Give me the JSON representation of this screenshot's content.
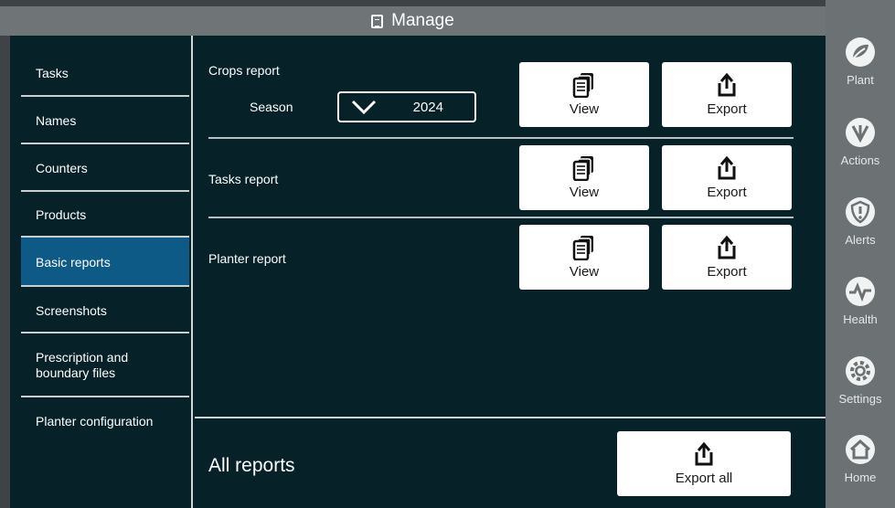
{
  "titlebar": {
    "title": "Manage",
    "icon": "document-icon"
  },
  "sidebar": {
    "items": [
      {
        "label": "Tasks",
        "active": false
      },
      {
        "label": "Names",
        "active": false
      },
      {
        "label": "Counters",
        "active": false
      },
      {
        "label": "Products",
        "active": false
      },
      {
        "label": "Basic reports",
        "active": true
      },
      {
        "label": "Screenshots",
        "active": false
      },
      {
        "label": "Prescription and\nboundary files",
        "active": false
      },
      {
        "label": "Planter configuration",
        "active": false
      }
    ]
  },
  "reports": {
    "crops": {
      "label": "Crops report",
      "season_label": "Season",
      "season_value": "2024",
      "view_label": "View",
      "export_label": "Export"
    },
    "tasks": {
      "label": "Tasks report",
      "view_label": "View",
      "export_label": "Export"
    },
    "planter": {
      "label": "Planter report",
      "view_label": "View",
      "export_label": "Export"
    },
    "all": {
      "label": "All reports",
      "export_all_label": "Export all"
    }
  },
  "rail": {
    "items": [
      {
        "label": "Plant",
        "icon": "plant-icon"
      },
      {
        "label": "Actions",
        "icon": "actions-icon"
      },
      {
        "label": "Alerts",
        "icon": "alert-shield-icon"
      },
      {
        "label": "Health",
        "icon": "heartbeat-icon"
      },
      {
        "label": "Settings",
        "icon": "gear-icon"
      },
      {
        "label": "Home",
        "icon": "home-icon"
      }
    ]
  },
  "colors": {
    "background": "#062128",
    "active_item": "#0c5a85",
    "titlebar": "#6f7477",
    "rail": "#6c7174"
  }
}
